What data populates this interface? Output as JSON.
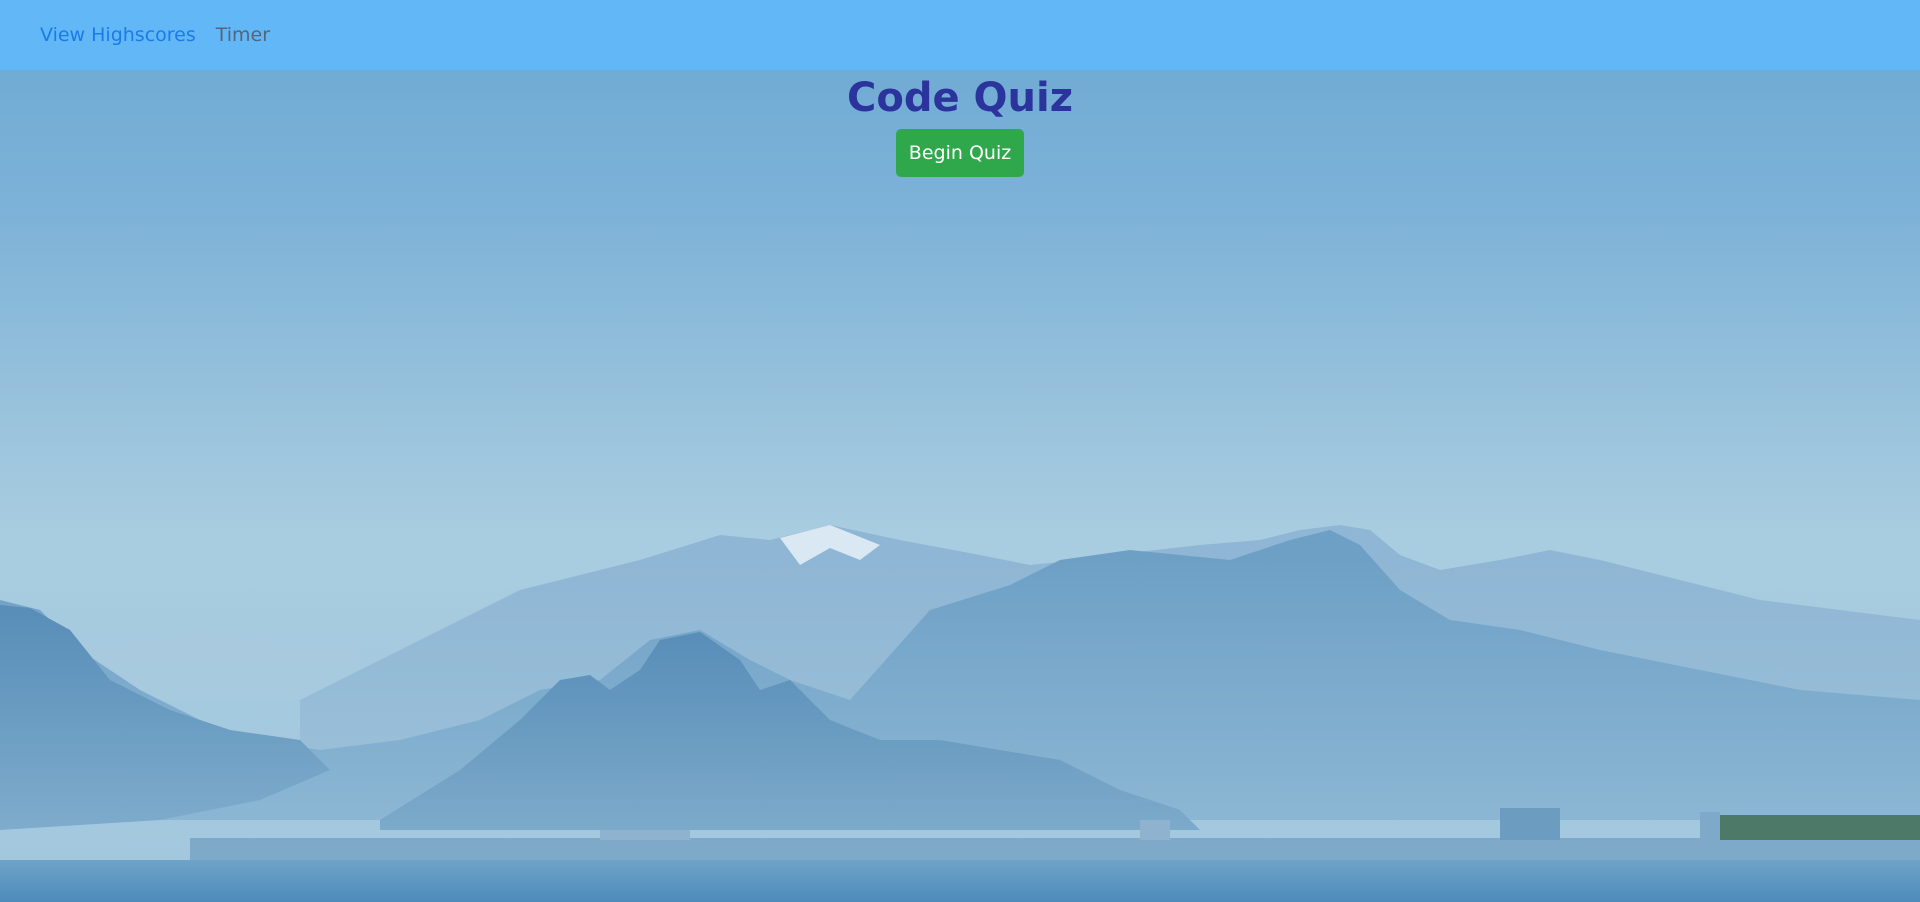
{
  "navbar": {
    "highscores_label": "View Highscores",
    "timer_label": "Timer"
  },
  "main": {
    "title": "Code Quiz",
    "begin_button_label": "Begin Quiz"
  },
  "colors": {
    "navbar_bg": "#62b7f7",
    "link_color": "#1c7be8",
    "title_color": "#2b349c",
    "button_bg": "#2ea84a"
  }
}
